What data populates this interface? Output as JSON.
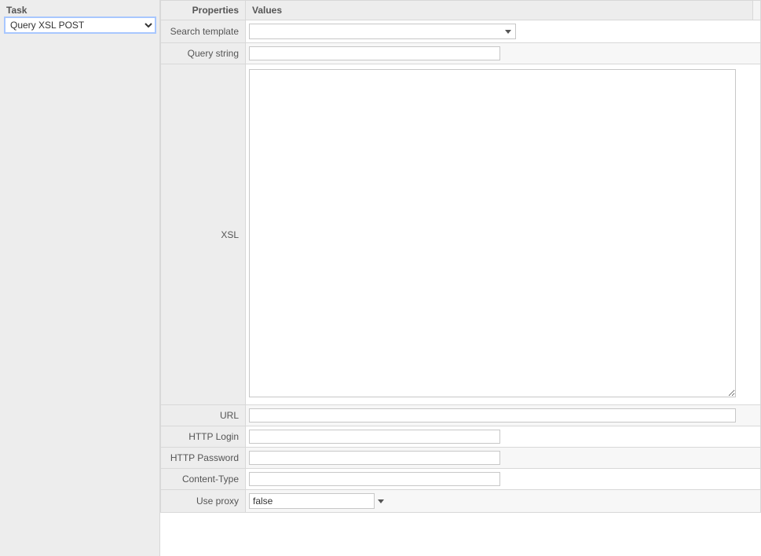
{
  "sidebar": {
    "task_label": "Task",
    "task_value": "Query XSL POST"
  },
  "headers": {
    "properties": "Properties",
    "values": "Values"
  },
  "rows": {
    "search_template": {
      "label": "Search template",
      "value": ""
    },
    "query_string": {
      "label": "Query string",
      "value": ""
    },
    "xsl": {
      "label": "XSL",
      "value": ""
    },
    "url": {
      "label": "URL",
      "value": ""
    },
    "http_login": {
      "label": "HTTP Login",
      "value": ""
    },
    "http_password": {
      "label": "HTTP Password",
      "value": ""
    },
    "content_type": {
      "label": "Content-Type",
      "value": ""
    },
    "use_proxy": {
      "label": "Use proxy",
      "value": "false"
    }
  }
}
